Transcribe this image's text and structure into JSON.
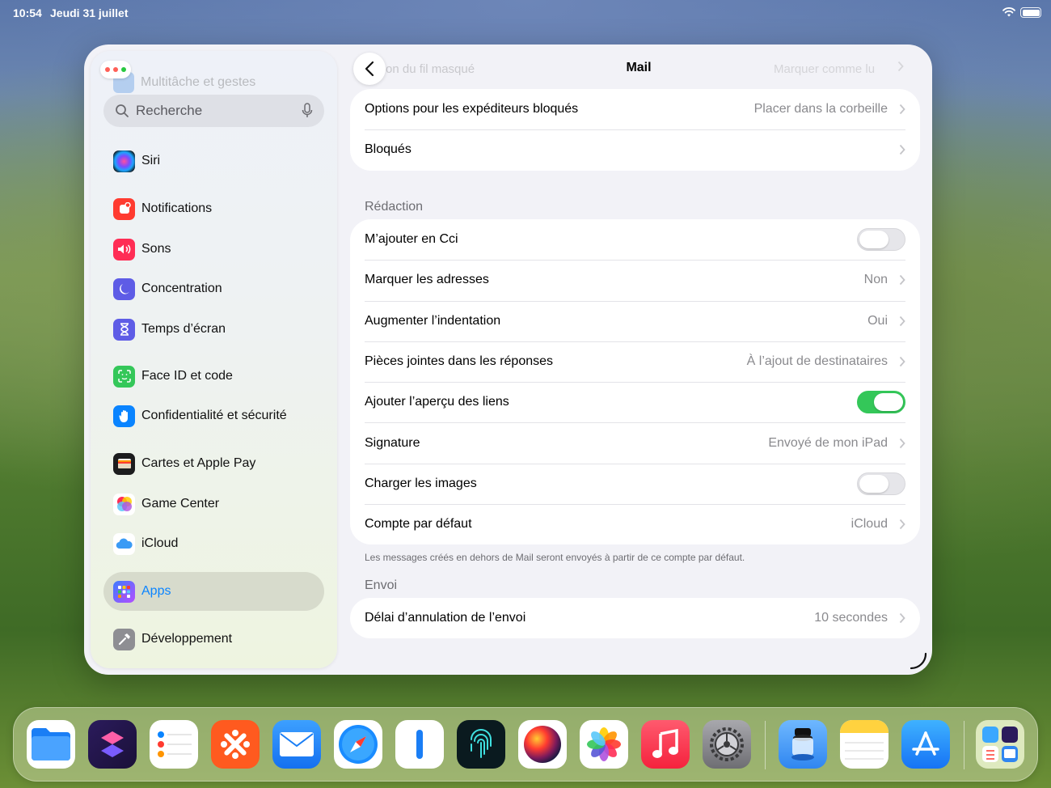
{
  "status_bar": {
    "time": "10:54",
    "date": "Jeudi 31 juillet"
  },
  "sidebar": {
    "faded_item": "Multitâche et gestes",
    "search_placeholder": "Recherche",
    "items": [
      {
        "label": "Siri",
        "icon": "siri-icon",
        "color": "#1c1c3c"
      },
      {
        "label": "Notifications",
        "icon": "notifications-icon",
        "color": "#ff3b30"
      },
      {
        "label": "Sons",
        "icon": "sounds-icon",
        "color": "#ff2d55"
      },
      {
        "label": "Concentration",
        "icon": "focus-moon-icon",
        "color": "#5e5ce6"
      },
      {
        "label": "Temps d’écran",
        "icon": "screen-time-hourglass-icon",
        "color": "#5e5ce6"
      },
      {
        "label": "Face ID et code",
        "icon": "face-id-icon",
        "color": "#34c759"
      },
      {
        "label": "Confidentialité et sécurité",
        "icon": "privacy-hand-icon",
        "color": "#0a84ff"
      },
      {
        "label": "Cartes et Apple Pay",
        "icon": "wallet-icon",
        "color": "#1c1c1e"
      },
      {
        "label": "Game Center",
        "icon": "game-center-icon",
        "color": "#ffffff"
      },
      {
        "label": "iCloud",
        "icon": "icloud-icon",
        "color": "#ffffff"
      },
      {
        "label": "Apps",
        "icon": "apps-grid-icon",
        "color": "#6e4ce6",
        "selected": true
      },
      {
        "label": "Développement",
        "icon": "developer-hammer-icon",
        "color": "#8e8e93"
      }
    ]
  },
  "main": {
    "nav": {
      "title": "Mail",
      "faded_left": "on du fil masqué",
      "faded_right": "Marquer comme lu"
    },
    "group_top": [
      {
        "label": "Options pour les expéditeurs bloqués",
        "value": "Placer dans la corbeille"
      },
      {
        "label": "Bloqués",
        "value": ""
      }
    ],
    "section_redaction": "Rédaction",
    "group_redaction": [
      {
        "label": "M’ajouter en Cci",
        "toggle": false
      },
      {
        "label": "Marquer les adresses",
        "value": "Non"
      },
      {
        "label": "Augmenter l’indentation",
        "value": "Oui"
      },
      {
        "label": "Pièces jointes dans les réponses",
        "value": "À l’ajout de destinataires"
      },
      {
        "label": "Ajouter l’aperçu des liens",
        "toggle": true
      },
      {
        "label": "Signature",
        "value": "Envoyé de mon iPad"
      },
      {
        "label": "Charger les images",
        "toggle": false
      },
      {
        "label": "Compte par défaut",
        "value": "iCloud"
      }
    ],
    "footer_redaction": "Les messages créés en dehors de Mail seront envoyés à partir de ce compte par défaut.",
    "section_envoi": "Envoi",
    "group_envoi": [
      {
        "label": "Délai d’annulation de l’envoi",
        "value": "10 secondes"
      }
    ]
  },
  "dock": {
    "apps": [
      {
        "name": "files-icon"
      },
      {
        "name": "shortcuts-icon"
      },
      {
        "name": "reminders-icon"
      },
      {
        "name": "pinwheel-app-icon"
      },
      {
        "name": "mail-icon"
      },
      {
        "name": "safari-icon"
      },
      {
        "name": "notes-bar-app-icon"
      },
      {
        "name": "fingerprint-app-icon"
      },
      {
        "name": "color-sphere-app-icon"
      },
      {
        "name": "photos-icon"
      },
      {
        "name": "music-icon"
      },
      {
        "name": "settings-icon"
      },
      {
        "name": "scanner-app-icon"
      },
      {
        "name": "notes-icon"
      },
      {
        "name": "app-store-icon"
      },
      {
        "name": "recent-apps-folder-icon"
      }
    ]
  },
  "colors": {
    "accent": "#0a84ff",
    "toggle_on": "#34c759",
    "secondary_text": "#8a8a8e"
  }
}
